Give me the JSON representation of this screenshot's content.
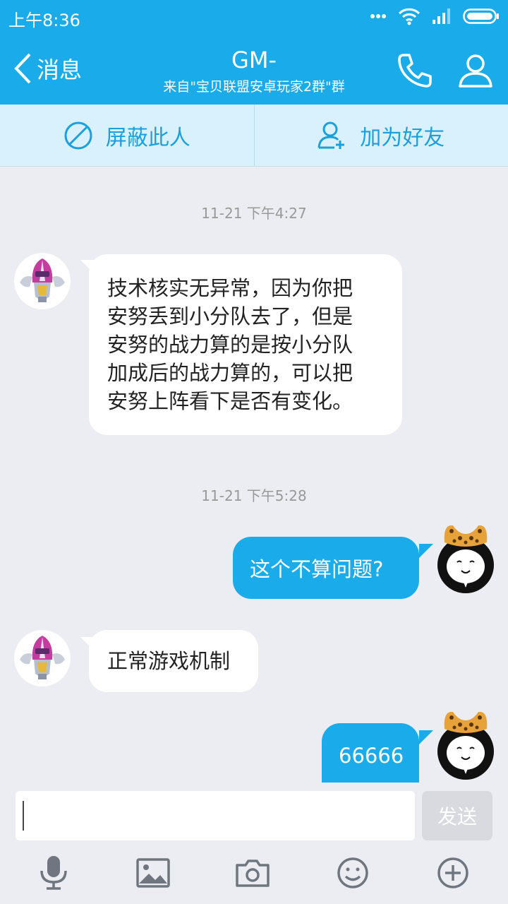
{
  "status": {
    "time": "上午8:36"
  },
  "header": {
    "back_label": "消息",
    "title": "GM-",
    "subtitle": "来自\"宝贝联盟安卓玩家2群\"群"
  },
  "actions": {
    "block_label": "屏蔽此人",
    "add_friend_label": "加为好友"
  },
  "messages": [
    {
      "type": "timestamp",
      "text": "11-21 下午4:27"
    },
    {
      "type": "incoming",
      "lines": [
        "技术核实无异常，因为你把",
        "安努丢到小分队去了，但是",
        "安努的战力算的是按小分队",
        "加成后的战力算的，可以把",
        "安努上阵看下是否有变化。"
      ]
    },
    {
      "type": "timestamp",
      "text": "11-21 下午5:28"
    },
    {
      "type": "outgoing",
      "text": "这个不算问题?"
    },
    {
      "type": "incoming",
      "text": "正常游戏机制"
    },
    {
      "type": "outgoing",
      "text": "66666"
    }
  ],
  "input": {
    "send_label": "发送"
  },
  "colors": {
    "brand": "#1AACEA",
    "action_bar": "#D8F1FC",
    "background": "#EBEDF2"
  }
}
